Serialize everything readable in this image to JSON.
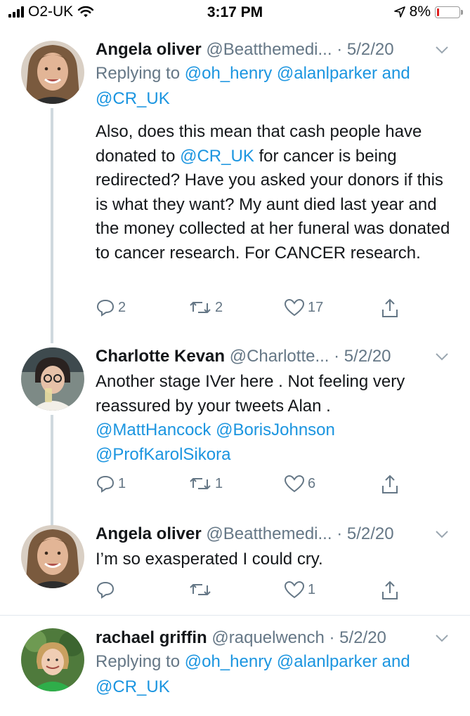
{
  "status_bar": {
    "carrier": "O2-UK",
    "time": "3:17 PM",
    "battery": "8%",
    "battery_level": 0.08,
    "icons": [
      "signal-bars-icon",
      "wifi-icon",
      "location-arrow-icon",
      "battery-icon"
    ]
  },
  "tweets": [
    {
      "name": "Angela oliver",
      "handle": "@Beatthemedi...",
      "date": "· 5/2/20",
      "replying_prefix": "Replying to",
      "replying_to": [
        "@oh_henry",
        "@alanlparker",
        "and",
        "@CR_UK"
      ],
      "text_before": "Also, does this mean that cash people have donated to ",
      "text_link": "@CR_UK",
      "text_after": " for cancer is being redirected? Have you asked your donors if this is what they want? My aunt died last year and the money collected at her funeral was donated to cancer research. For CANCER research.",
      "replies": "2",
      "retweets": "2",
      "likes": "17"
    },
    {
      "name": "Charlotte Kevan",
      "handle": "@Charlotte...",
      "date": "· 5/2/20",
      "text": "Another stage IVer here . Not feeling very reassured by your tweets Alan .",
      "mentions": [
        "@MattHancock",
        "@BorisJohnson",
        "@ProfKarolSikora"
      ],
      "replies": "1",
      "retweets": "1",
      "likes": "6"
    },
    {
      "name": "Angela oliver",
      "handle": "@Beatthemedi...",
      "date": "· 5/2/20",
      "text": "I’m so exasperated I could cry.",
      "replies": "",
      "retweets": "",
      "likes": "1"
    },
    {
      "name": "rachael griffin",
      "handle": "@raquelwench",
      "date": "· 5/2/20",
      "replying_prefix": "Replying to",
      "replying_to": [
        "@oh_henry",
        "@alanlparker",
        "and",
        "@CR_UK"
      ]
    }
  ],
  "colors": {
    "link": "#1b95e0",
    "secondary_text": "#657786",
    "primary_text": "#14171a",
    "thread_line": "#cfd9de",
    "battery_low": "#e02020"
  }
}
